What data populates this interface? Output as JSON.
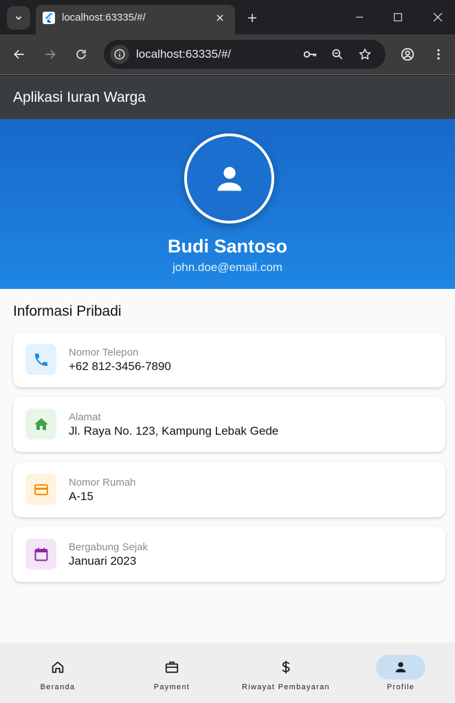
{
  "browser": {
    "tab_title": "localhost:63335/#/",
    "url": "localhost:63335/#/"
  },
  "app": {
    "title": "Aplikasi Iuran Warga"
  },
  "profile": {
    "name": "Budi Santoso",
    "email": "john.doe@email.com"
  },
  "section": {
    "title": "Informasi Pribadi"
  },
  "info_cards": [
    {
      "label": "Nomor Telepon",
      "value": "+62 812-3456-7890",
      "icon": "phone-icon",
      "color": "#1e88e5",
      "bg": "#e3f2fd"
    },
    {
      "label": "Alamat",
      "value": "Jl. Raya No. 123, Kampung Lebak Gede",
      "icon": "home-icon",
      "color": "#43a047",
      "bg": "#e8f5e9"
    },
    {
      "label": "Nomor Rumah",
      "value": "A-15",
      "icon": "credit-card-icon",
      "color": "#fb8c00",
      "bg": "#fff3e0"
    },
    {
      "label": "Bergabung Sejak",
      "value": "Januari 2023",
      "icon": "calendar-icon",
      "color": "#8e24aa",
      "bg": "#f3e5f5"
    }
  ],
  "bottom_nav": [
    {
      "label": "Beranda",
      "icon": "home-outline-icon"
    },
    {
      "label": "Payment",
      "icon": "briefcase-icon"
    },
    {
      "label": "Riwayat Pembayaran",
      "icon": "dollar-icon"
    },
    {
      "label": "Profile",
      "icon": "person-icon",
      "active": true
    }
  ],
  "colors": {
    "appbar": "#3a3d40",
    "hero_top": "#1868c8",
    "hero_bottom": "#1f86e3",
    "active_pill": "#c8def3"
  }
}
